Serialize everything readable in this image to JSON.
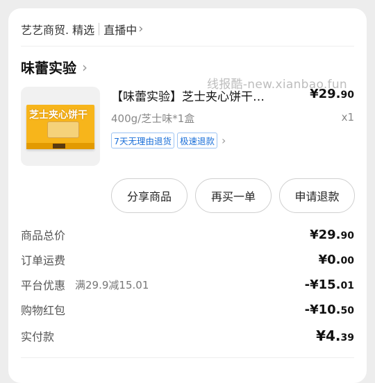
{
  "topbar": {
    "store": "艺艺商贸. 精选",
    "live": "直播中"
  },
  "shop": {
    "name": "味蕾实验"
  },
  "watermark": "线报酷-new.xianbao.fun",
  "product": {
    "image_text": "芝士夹心饼干",
    "name": "【味蕾实验】芝士夹心饼干…",
    "price_int": "¥29.",
    "price_dec": "90",
    "spec": "400g/芝士味*1盒",
    "qty": "x1",
    "tags": [
      "7天无理由退货",
      "极速退款"
    ]
  },
  "actions": {
    "share": "分享商品",
    "rebuy": "再买一单",
    "refund": "申请退款"
  },
  "summary": {
    "total": {
      "label": "商品总价",
      "int": "¥29.",
      "dec": "90"
    },
    "shipping": {
      "label": "订单运费",
      "int": "¥0.",
      "dec": "00"
    },
    "platform": {
      "label": "平台优惠",
      "note": "满29.9减15.01",
      "int": "-¥15.",
      "dec": "01"
    },
    "redpacket": {
      "label": "购物红包",
      "int": "-¥10.",
      "dec": "50"
    },
    "paid": {
      "label": "实付款",
      "int": "¥4.",
      "dec": "39"
    }
  }
}
